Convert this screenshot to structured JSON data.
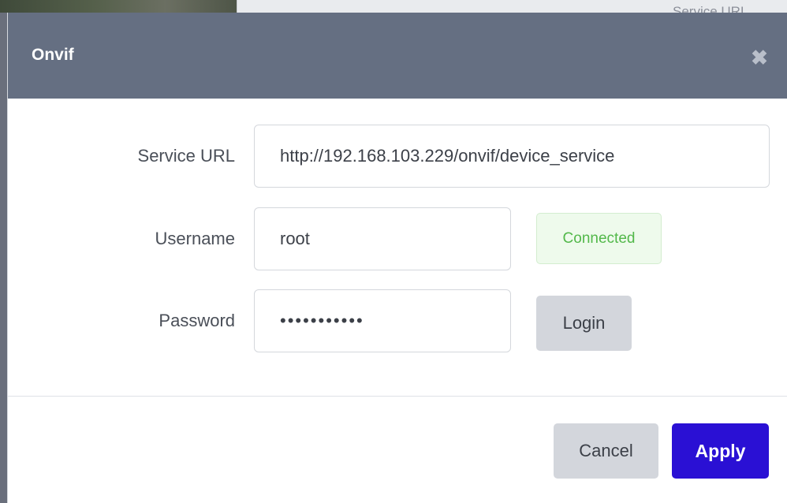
{
  "backdrop": {
    "partial_label": "Service URL"
  },
  "modal": {
    "title": "Onvif",
    "close_icon": "close-icon"
  },
  "form": {
    "service_url": {
      "label": "Service URL",
      "value": "http://192.168.103.229/onvif/device_service"
    },
    "username": {
      "label": "Username",
      "value": "root"
    },
    "password": {
      "label": "Password",
      "value": "•••••••••••"
    },
    "status": {
      "text": "Connected",
      "color": "#52b84a"
    },
    "login_label": "Login"
  },
  "footer": {
    "cancel_label": "Cancel",
    "apply_label": "Apply",
    "apply_color": "#2a10d4"
  }
}
